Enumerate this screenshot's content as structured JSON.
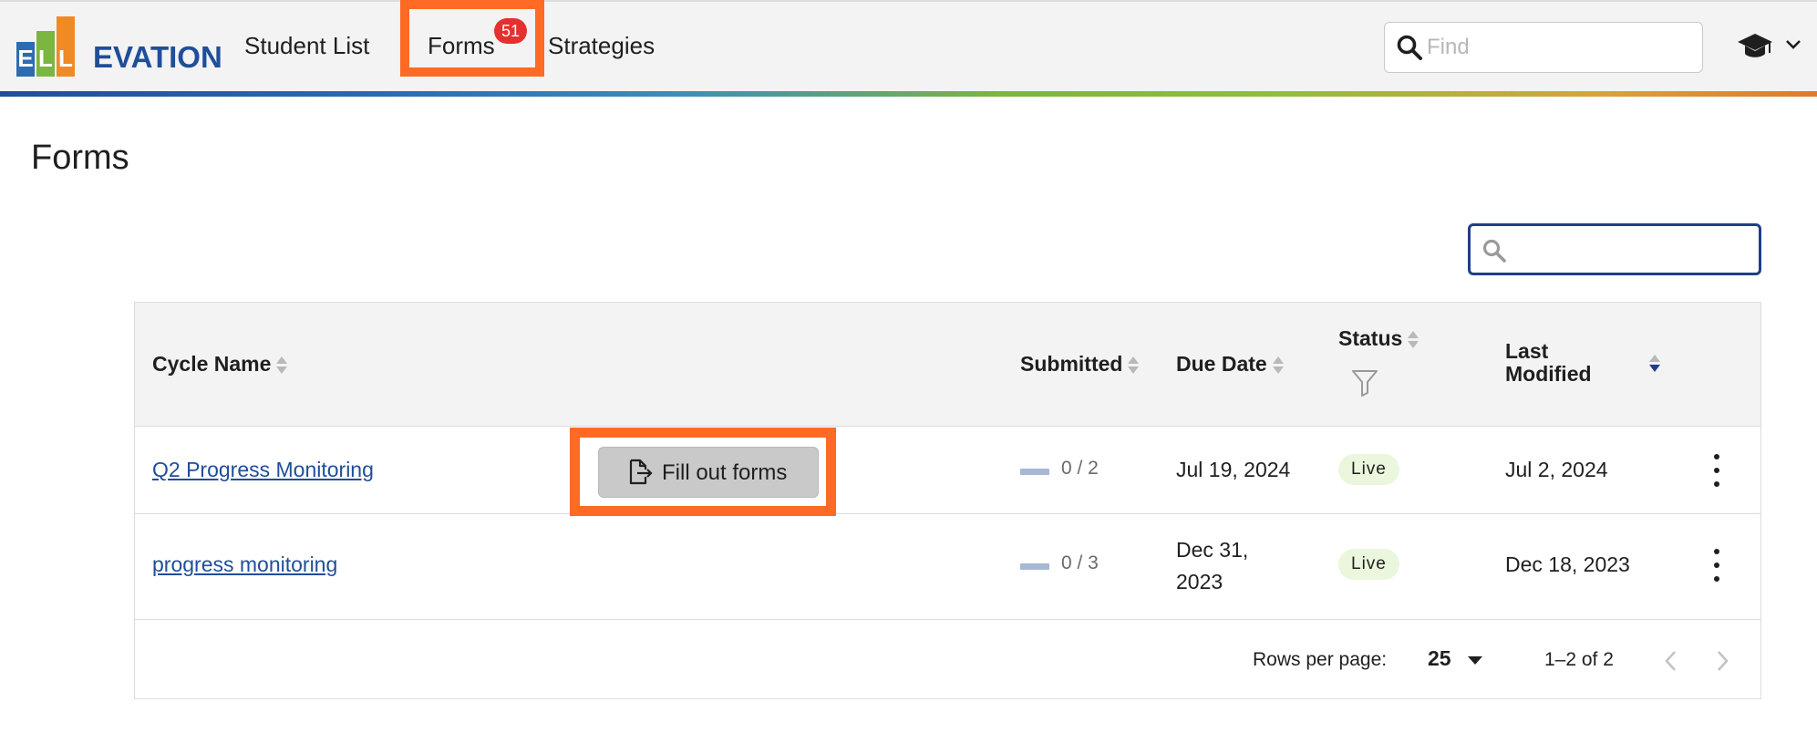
{
  "brand": {
    "logo_letters": [
      "E",
      "L",
      "L"
    ],
    "logo_rest": "EVATION",
    "logo_colors": [
      "#2b6cb3",
      "#7ab640",
      "#f08a24"
    ],
    "brand_blue": "#1f4e9a"
  },
  "nav": {
    "items": [
      {
        "label": "Student List"
      },
      {
        "label": "Forms",
        "badge": "51"
      },
      {
        "label": "Strategies"
      }
    ],
    "find_placeholder": "Find",
    "search_icon": "search-icon",
    "user_icon": "graduation-cap-icon",
    "menu_icon": "chevron-down-icon"
  },
  "highlight_color": "#ff6a24",
  "page": {
    "title": "Forms"
  },
  "table": {
    "search_placeholder": "",
    "headers": {
      "cycle_name": "Cycle Name",
      "submitted": "Submitted",
      "due_date": "Due Date",
      "status": "Status",
      "last_modified_line1": "Last",
      "last_modified_line2": "Modified"
    },
    "status_filter_icon": "filter-icon",
    "rows": [
      {
        "cycle_name": "Q2 Progress Monitoring",
        "action_label": "Fill out forms",
        "action_icon": "file-export-icon",
        "submitted": "0 / 2",
        "submitted_progress": 0,
        "due_date": "Jul 19, 2024",
        "status": "Live",
        "last_modified": "Jul 2, 2024"
      },
      {
        "cycle_name": "progress monitoring",
        "submitted": "0 / 3",
        "submitted_progress": 0,
        "due_date_line1": "Dec 31,",
        "due_date_line2": "2023",
        "status": "Live",
        "last_modified": "Dec 18, 2023"
      }
    ],
    "pagination": {
      "rows_per_page_label": "Rows per page:",
      "rows_per_page": "25",
      "range": "1–2 of 2",
      "prev_icon": "chevron-left-icon",
      "next_icon": "chevron-right-icon"
    }
  }
}
